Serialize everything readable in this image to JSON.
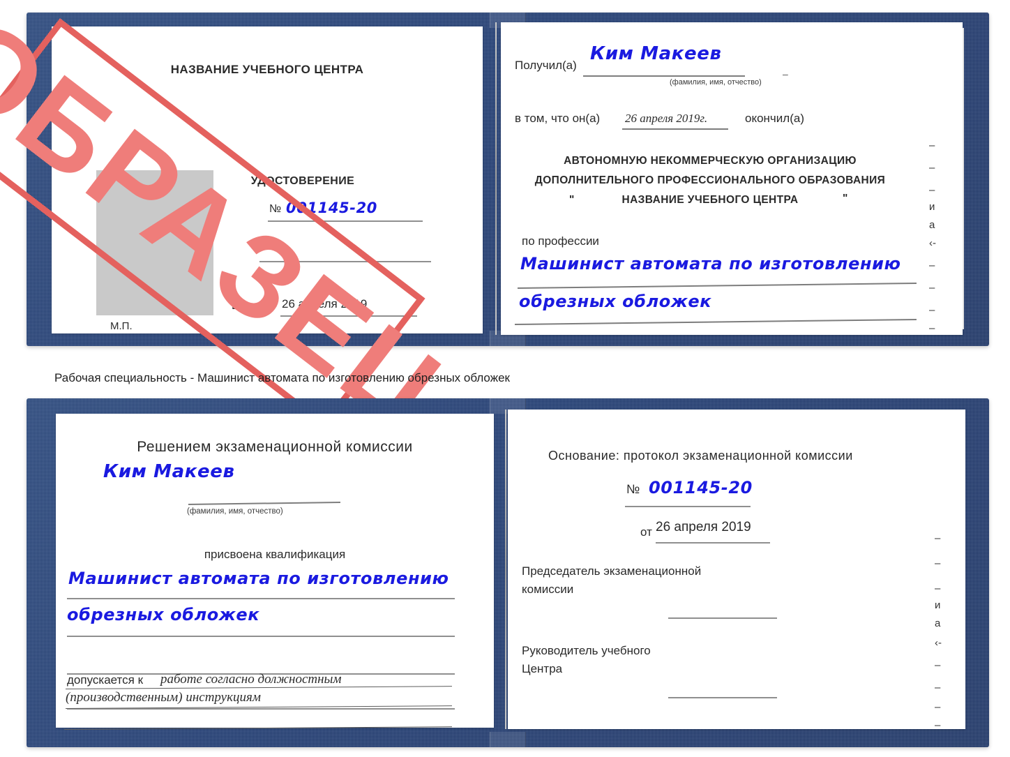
{
  "caption": "Рабочая специальность - Машинист автомата по изготовлению обрезных обложек",
  "watermark": {
    "text": "ОБРАЗЕЦ",
    "color": "#ef7d7a",
    "border_color": "#e4615e"
  },
  "colors": {
    "cover_blue": "#1e3a76",
    "paper_white": "#ffffff",
    "handwriting_blue": "#1a1ae0",
    "photo_placeholder_gray": "#c9c9c9",
    "rule_gray": "#8f8f8f"
  },
  "certificate_top": {
    "left_page": {
      "org_title": "НАЗВАНИЕ УЧЕБНОГО ЦЕНТРА",
      "doc_type": "УДОСТОВЕРЕНИЕ",
      "number_label": "№",
      "number_value": "001145-20",
      "issued_label": "Выдано",
      "issued_value": "26 апреля 2019",
      "stamp_label": "М.П."
    },
    "right_page": {
      "received_label": "Получил(а)",
      "received_value": "Ким Макеев",
      "fio_hint": "(фамилия, имя, отчество)",
      "in_that_label": "в том, что он(а)",
      "completion_date": "26 апреля 2019г.",
      "finished_label": "окончил(а)",
      "org_line1": "АВТОНОМНУЮ НЕКОММЕРЧЕСКУЮ ОРГАНИЗАЦИЮ",
      "org_line2": "ДОПОЛНИТЕЛЬНОГО ПРОФЕССИОНАЛЬНОГО ОБРАЗОВАНИЯ",
      "org_quote_open": "\"",
      "org_line3": "НАЗВАНИЕ УЧЕБНОГО ЦЕНТРА",
      "org_quote_close": "\"",
      "profession_label": "по профессии",
      "profession_line1": "Машинист автомата по изготовлению",
      "profession_line2": "обрезных обложек",
      "edge_fragments": [
        "–",
        "–",
        "–",
        "и",
        "а",
        "‹-",
        "–",
        "–",
        "–",
        "–"
      ]
    }
  },
  "certificate_bottom": {
    "left_page": {
      "decision_title": "Решением экзаменационной комиссии",
      "name_value": "Ким Макеев",
      "fio_hint": "(фамилия, имя, отчество)",
      "qualification_label": "присвоена квалификация",
      "qualification_line1": "Машинист автомата по изготовлению",
      "qualification_line2": "обрезных обложек",
      "allowed_label": "допускается к",
      "allowed_value_line1": "работе согласно должностным",
      "allowed_value_line2": "(производственным) инструкциям"
    },
    "right_page": {
      "basis_label": "Основание: протокол экзаменационной комиссии",
      "number_label": "№",
      "number_value": "001145-20",
      "from_label": "от",
      "from_value": "26 апреля 2019",
      "chairman_line1": "Председатель экзаменационной",
      "chairman_line2": "комиссии",
      "head_line1": "Руководитель учебного",
      "head_line2": "Центра",
      "edge_fragments": [
        "–",
        "–",
        "–",
        "и",
        "а",
        "‹-",
        "–",
        "–",
        "–",
        "–"
      ]
    }
  }
}
